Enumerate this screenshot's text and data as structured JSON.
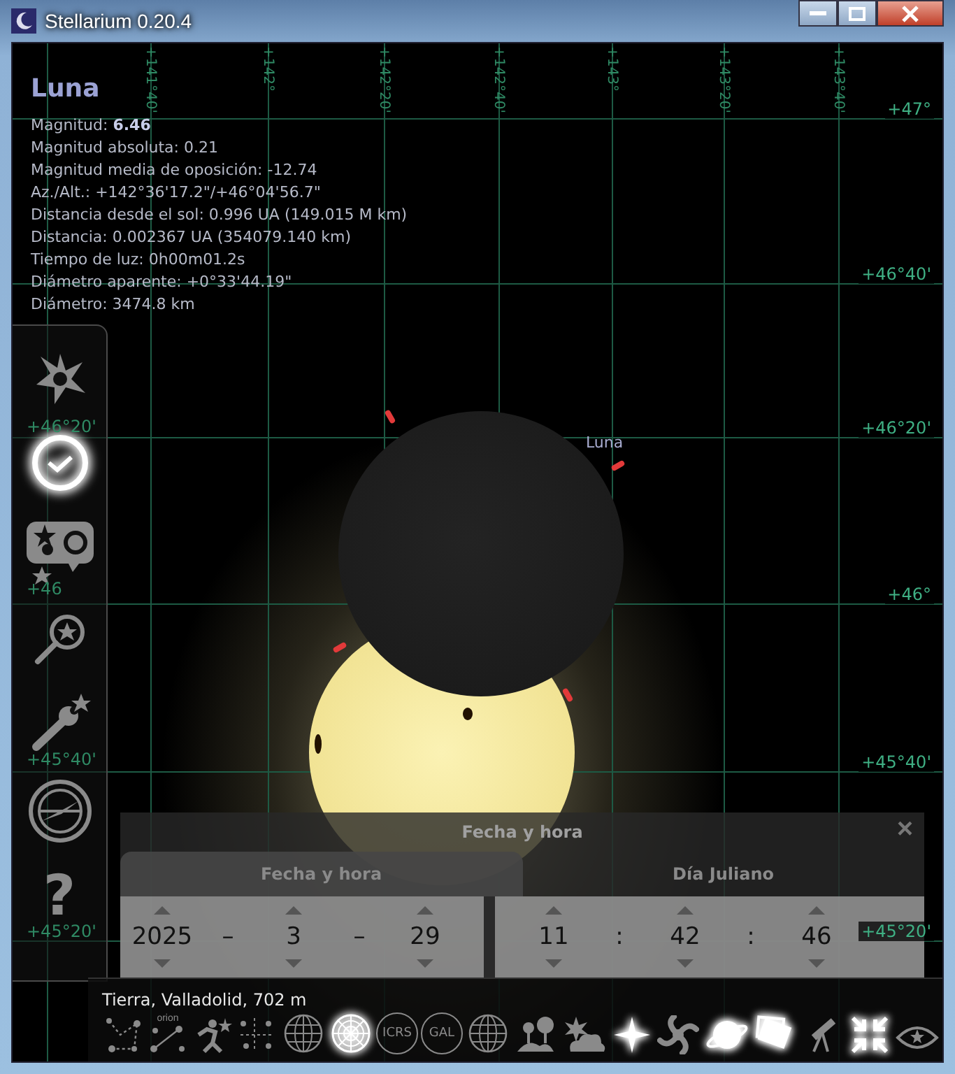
{
  "window": {
    "title": "Stellarium 0.20.4"
  },
  "sky": {
    "azimuth_labels": [
      "+141°40'",
      "+142°",
      "+142°20'",
      "+142°40'",
      "+143°",
      "+143°20'",
      "+143°40'"
    ],
    "altitude_labels": [
      "+47°",
      "+46°40'",
      "+46°20'",
      "+46°",
      "+45°40'",
      "+45°20'"
    ],
    "left_altitude_labels": [
      "+46°20'",
      "+46",
      "+45°40'",
      "+45°20'"
    ],
    "object_label": "Luna"
  },
  "info": {
    "name": "Luna",
    "lines": [
      "Magnitud: **6.46**",
      "Magnitud absoluta: 0.21",
      "Magnitud media de oposición: -12.74",
      "Az./Alt.: +142°36'17.2\"/+46°04'56.7\"",
      "Distancia desde el sol: 0.996 UA (149.015 M km)",
      "Distancia: 0.002367 UA (354079.140 km)",
      "Tiempo de luz: 0h00m01.2s",
      "Diámetro aparente: +0°33'44.19\"",
      "Diámetro: 3474.8 km"
    ]
  },
  "left_toolbar": [
    {
      "kind": "sky",
      "selected": false
    },
    {
      "kind": "clock",
      "selected": true
    },
    {
      "kind": "objects",
      "selected": false
    },
    {
      "kind": "search",
      "selected": false
    },
    {
      "kind": "wrench",
      "selected": false
    },
    {
      "kind": "compass",
      "selected": false
    },
    {
      "kind": "help",
      "label": "?",
      "selected": false
    }
  ],
  "dialog": {
    "title": "Fecha y hora",
    "close": "×",
    "tabs": [
      {
        "label": "Fecha y hora",
        "selected": true
      },
      {
        "label": "Día Juliano",
        "selected": false
      }
    ],
    "fields": [
      {
        "kind": "spin",
        "value": "2025"
      },
      {
        "kind": "sep",
        "text": "–"
      },
      {
        "kind": "spin",
        "value": "3"
      },
      {
        "kind": "sep",
        "text": "–"
      },
      {
        "kind": "spin",
        "value": "29"
      },
      {
        "kind": "gap"
      },
      {
        "kind": "spin",
        "value": "11"
      },
      {
        "kind": "sep",
        "text": ":"
      },
      {
        "kind": "spin",
        "value": "42"
      },
      {
        "kind": "sep",
        "text": ":"
      },
      {
        "kind": "spin",
        "value": "46"
      }
    ]
  },
  "bottom_bar": {
    "location": "Tierra, Valladolid, 702 m",
    "buttons": [
      {
        "kind": "lines",
        "selected": false
      },
      {
        "kind": "names",
        "label": "orion",
        "selected": false
      },
      {
        "kind": "art",
        "selected": false
      },
      {
        "kind": "boundaries",
        "selected": false
      },
      {
        "kind": "globe",
        "selected": false
      },
      {
        "kind": "polar",
        "selected": true
      },
      {
        "kind": "ring",
        "label": "ICRS",
        "selected": false
      },
      {
        "kind": "ring",
        "label": "GAL",
        "selected": false
      },
      {
        "kind": "globe",
        "selected": false
      },
      {
        "kind": "landscape",
        "selected": false
      },
      {
        "kind": "cloud",
        "selected": false
      },
      {
        "kind": "star",
        "selected": true
      },
      {
        "kind": "spiral",
        "selected": false
      },
      {
        "kind": "planet",
        "selected": true
      },
      {
        "kind": "cards",
        "selected": true
      },
      {
        "kind": "telescope",
        "selected": false
      },
      {
        "kind": "fullscreen",
        "selected": true
      },
      {
        "kind": "eye",
        "selected": false
      }
    ]
  }
}
